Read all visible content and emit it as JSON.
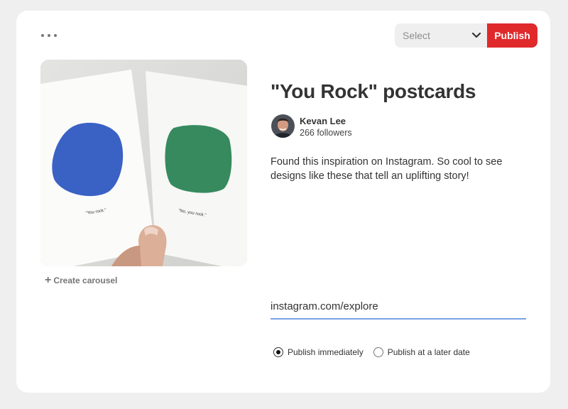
{
  "toolbar": {
    "more_icon": "more-horizontal-icon",
    "board_select": {
      "selected": "Select",
      "placeholder": "Select"
    },
    "publish_label": "Publish",
    "accent_color": "#e0292b"
  },
  "pin": {
    "title": "\"You Rock\" postcards",
    "image": {
      "card_left_caption": "\"You rock.\"",
      "card_right_caption": "\"No, you rock.\"",
      "blue_color": "#3a62c5",
      "green_color": "#368a5e"
    },
    "create_carousel_label": "Create carousel",
    "author": {
      "name": "Kevan Lee",
      "followers": "266 followers"
    },
    "description": "Found this inspiration on Instagram. So cool to see designs like these that tell an uplifting story!",
    "link": {
      "value": "instagram.com/explore",
      "underline_color": "#7aa3e5"
    }
  },
  "schedule": {
    "options": [
      {
        "label": "Publish immediately",
        "selected": true
      },
      {
        "label": "Publish at a later date",
        "selected": false
      }
    ]
  }
}
